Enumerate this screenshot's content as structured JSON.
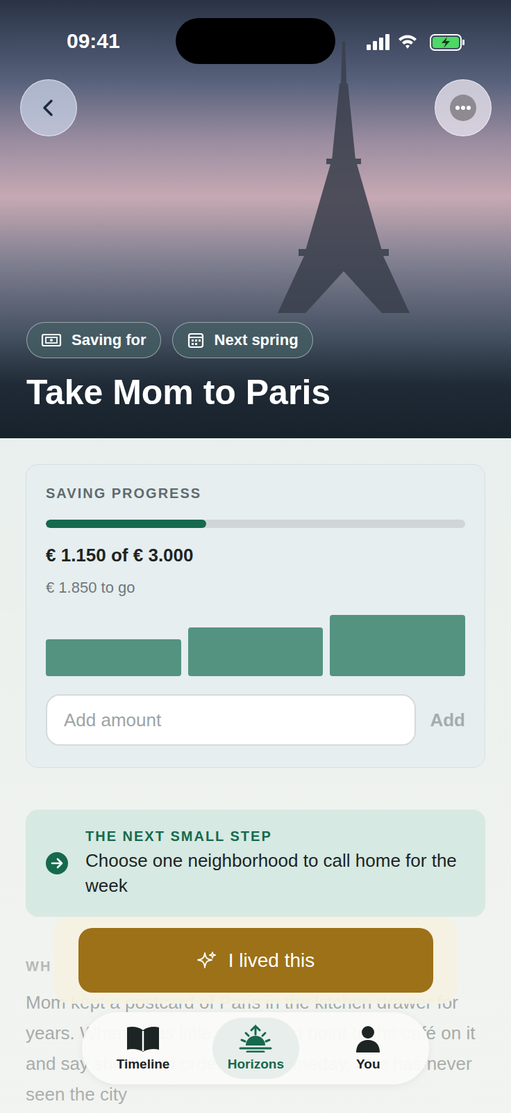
{
  "status_bar": {
    "time": "09:41"
  },
  "hero": {
    "chips": [
      {
        "label": "Saving for"
      },
      {
        "label": "Next spring"
      }
    ],
    "title": "Take Mom to Paris"
  },
  "saving": {
    "label": "SAVING PROGRESS",
    "level": 0.383,
    "amount": "€ 1.150 of € 3.000",
    "remaining": "€ 1.850 to go",
    "chart": {
      "values": [
        290,
        380,
        480
      ]
    },
    "input": {
      "placeholder": "Add amount"
    },
    "add_button": "Add"
  },
  "next_step": {
    "label": "THE NEXT SMALL STEP",
    "text": "Choose one neighborhood to call home for the week"
  },
  "story": {
    "heading": "WH",
    "text": "Mom kept a postcard of Paris in the kitchen drawer for years. When I was little, she would point to the café on it and say she would order there someday. She has never seen the city"
  },
  "action_button": "I lived this",
  "tabs": [
    {
      "label": "Timeline",
      "selected": false
    },
    {
      "label": "Horizons",
      "selected": true
    },
    {
      "label": "You",
      "selected": false
    }
  ]
}
